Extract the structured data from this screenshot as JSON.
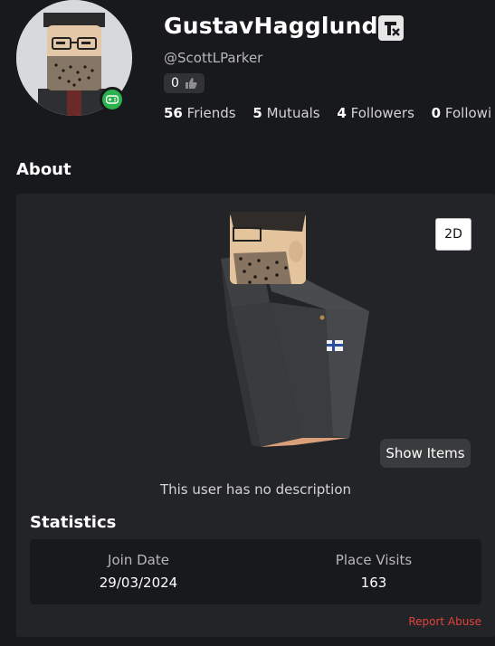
{
  "profile": {
    "display_name": "GustavHagglund",
    "handle": "@ScottLParker",
    "badge_count": "0",
    "friends_count": "56",
    "friends_label": "Friends",
    "mutuals_count": "5",
    "mutuals_label": "Mutuals",
    "followers_count": "4",
    "followers_label": "Followers",
    "following_count": "0",
    "following_label": "Followi"
  },
  "about": {
    "title": "About",
    "view_toggle": "2D",
    "show_items": "Show Items",
    "description": "This user has no description"
  },
  "statistics": {
    "title": "Statistics",
    "join_date_label": "Join Date",
    "join_date_value": "29/03/2024",
    "place_visits_label": "Place Visits",
    "place_visits_value": "163"
  },
  "report": "Report Abuse",
  "icons": {
    "presence": "gamepad-icon",
    "premium": "premium-icon",
    "badge": "thumbs-up-icon"
  },
  "colors": {
    "background": "#18191c",
    "card": "#232428",
    "presence": "#2cb34d",
    "report": "#e0423b"
  }
}
